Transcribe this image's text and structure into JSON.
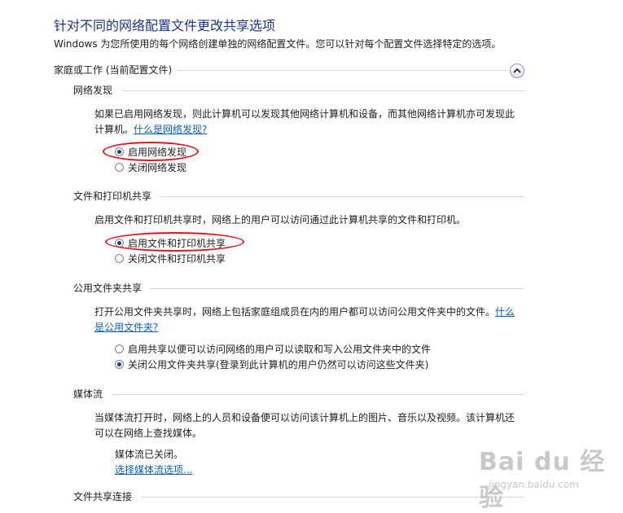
{
  "title": "针对不同的网络配置文件更改共享选项",
  "intro": "Windows 为您所使用的每个网络创建单独的网络配置文件。您可以针对每个配置文件选择特定的选项。",
  "group": {
    "label": "家庭或工作 (当前配置文件)"
  },
  "network_discovery": {
    "header": "网络发现",
    "desc": "如果已启用网络发现，则此计算机可以发现其他网络计算机和设备，而其他网络计算机亦可发现此计算机。",
    "link": "什么是网络发现?",
    "options": [
      "启用网络发现",
      "关闭网络发现"
    ],
    "selected": 0
  },
  "file_printer_sharing": {
    "header": "文件和打印机共享",
    "desc": "启用文件和打印机共享时，网络上的用户可以访问通过此计算机共享的文件和打印机。",
    "options": [
      "启用文件和打印机共享",
      "关闭文件和打印机共享"
    ],
    "selected": 0
  },
  "public_folder_sharing": {
    "header": "公用文件夹共享",
    "desc": "打开公用文件夹共享时，网络上包括家庭组成员在内的用户都可以访问公用文件夹中的文件。",
    "link": "什么是公用文件夹?",
    "options": [
      "启用共享以便可以访问网络的用户可以读取和写入公用文件夹中的文件",
      "关闭公用文件夹共享(登录到此计算机的用户仍然可以访问这些文件夹)"
    ],
    "selected": 1
  },
  "media_streaming": {
    "header": "媒体流",
    "desc": "当媒体流打开时，网络上的人员和设备便可以访问该计算机上的图片、音乐以及视频。该计算机还可以在网络上查找媒体。",
    "status": "媒体流已关闭。",
    "link": "选择媒体流选项..."
  },
  "file_sharing_connections": {
    "header": "文件共享连接"
  },
  "watermark": {
    "text": "Bai du 经验",
    "url": "jingyan.baidu.com"
  },
  "colors": {
    "title": "#1e3287",
    "link": "#0a5fb4",
    "highlight": "#e0141a"
  }
}
